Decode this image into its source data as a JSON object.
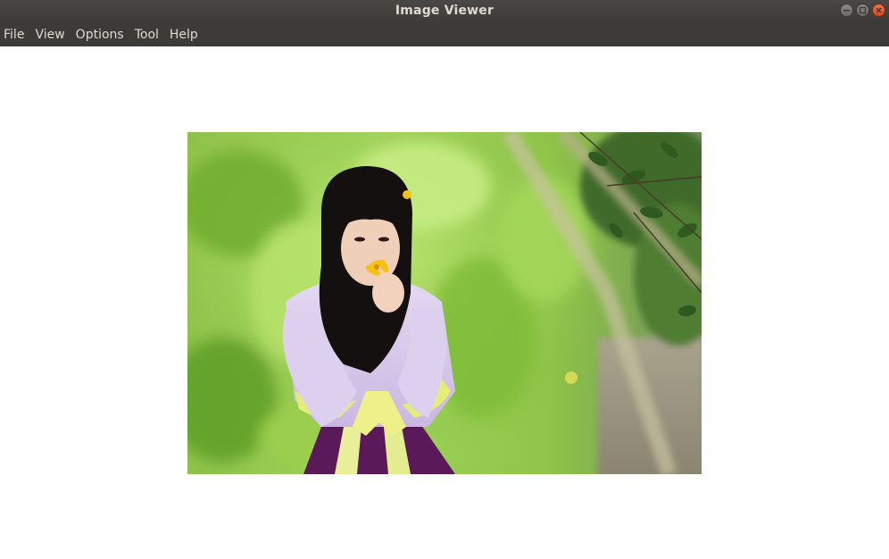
{
  "window": {
    "title": "Image Viewer"
  },
  "menubar": {
    "items": [
      {
        "label": "File"
      },
      {
        "label": "View"
      },
      {
        "label": "Options"
      },
      {
        "label": "Tool"
      },
      {
        "label": "Help"
      }
    ]
  },
  "icons": {
    "minimize": "minimize-icon",
    "maximize": "maximize-icon",
    "close": "close-icon"
  },
  "colors": {
    "titlebar": "#3c3b37",
    "menu_text": "#dfdbd2",
    "close_button": "#e05a2b",
    "canvas": "#ffffff"
  }
}
